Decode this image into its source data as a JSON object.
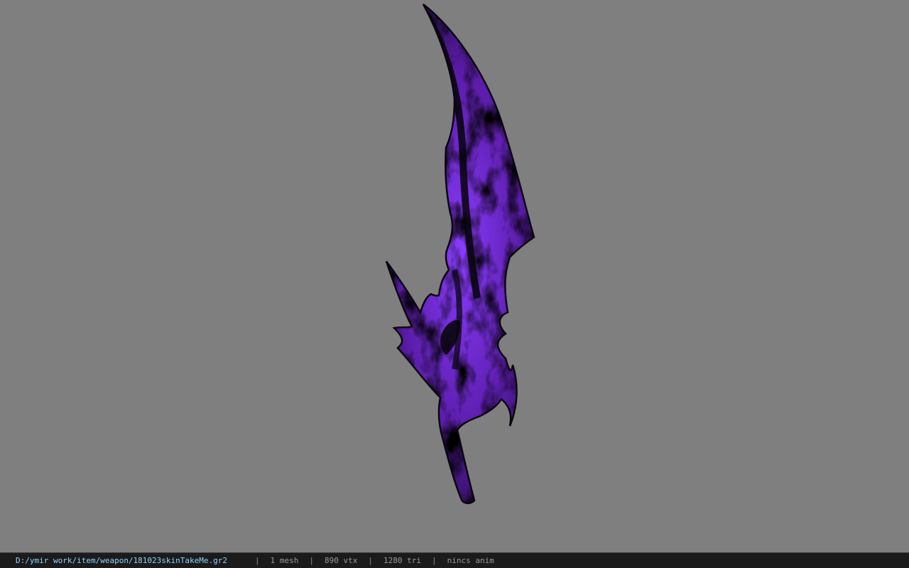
{
  "viewport": {
    "background_color": "#7f7f7f",
    "model": {
      "name": "sword-model",
      "primary_color": "#5a1ca8",
      "highlight_color": "#8a3cff",
      "shadow_color": "#050308"
    }
  },
  "status_bar": {
    "file_path": "D:/ymir work/item/weapon/181023skinTakeMe.gr2",
    "separator": "|",
    "mesh_count": "1 mesh",
    "vertex_count": "890 vtx",
    "triangle_count": "1280 tri",
    "anim_status": "nincs anim"
  }
}
